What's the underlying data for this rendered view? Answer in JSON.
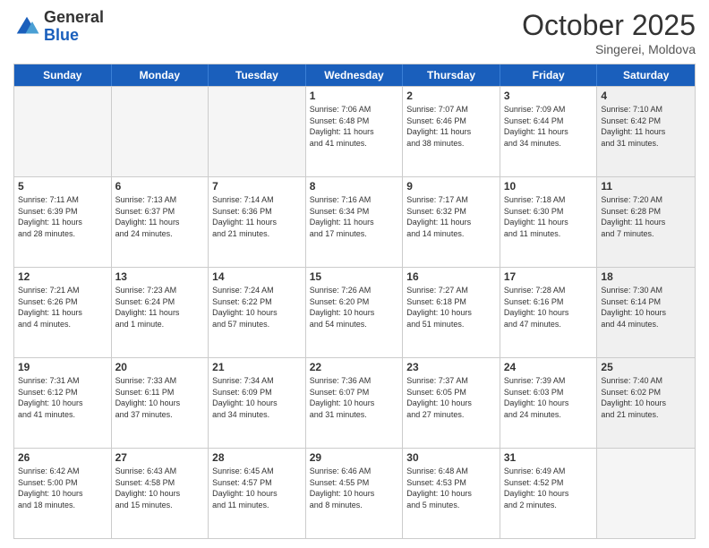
{
  "header": {
    "logo_general": "General",
    "logo_blue": "Blue",
    "month_title": "October 2025",
    "subtitle": "Singerei, Moldova"
  },
  "days_of_week": [
    "Sunday",
    "Monday",
    "Tuesday",
    "Wednesday",
    "Thursday",
    "Friday",
    "Saturday"
  ],
  "weeks": [
    [
      {
        "day": "",
        "info": "",
        "empty": true
      },
      {
        "day": "",
        "info": "",
        "empty": true
      },
      {
        "day": "",
        "info": "",
        "empty": true
      },
      {
        "day": "1",
        "info": "Sunrise: 7:06 AM\nSunset: 6:48 PM\nDaylight: 11 hours\nand 41 minutes.",
        "empty": false
      },
      {
        "day": "2",
        "info": "Sunrise: 7:07 AM\nSunset: 6:46 PM\nDaylight: 11 hours\nand 38 minutes.",
        "empty": false
      },
      {
        "day": "3",
        "info": "Sunrise: 7:09 AM\nSunset: 6:44 PM\nDaylight: 11 hours\nand 34 minutes.",
        "empty": false
      },
      {
        "day": "4",
        "info": "Sunrise: 7:10 AM\nSunset: 6:42 PM\nDaylight: 11 hours\nand 31 minutes.",
        "empty": false,
        "shaded": true
      }
    ],
    [
      {
        "day": "5",
        "info": "Sunrise: 7:11 AM\nSunset: 6:39 PM\nDaylight: 11 hours\nand 28 minutes.",
        "empty": false
      },
      {
        "day": "6",
        "info": "Sunrise: 7:13 AM\nSunset: 6:37 PM\nDaylight: 11 hours\nand 24 minutes.",
        "empty": false
      },
      {
        "day": "7",
        "info": "Sunrise: 7:14 AM\nSunset: 6:36 PM\nDaylight: 11 hours\nand 21 minutes.",
        "empty": false
      },
      {
        "day": "8",
        "info": "Sunrise: 7:16 AM\nSunset: 6:34 PM\nDaylight: 11 hours\nand 17 minutes.",
        "empty": false
      },
      {
        "day": "9",
        "info": "Sunrise: 7:17 AM\nSunset: 6:32 PM\nDaylight: 11 hours\nand 14 minutes.",
        "empty": false
      },
      {
        "day": "10",
        "info": "Sunrise: 7:18 AM\nSunset: 6:30 PM\nDaylight: 11 hours\nand 11 minutes.",
        "empty": false
      },
      {
        "day": "11",
        "info": "Sunrise: 7:20 AM\nSunset: 6:28 PM\nDaylight: 11 hours\nand 7 minutes.",
        "empty": false,
        "shaded": true
      }
    ],
    [
      {
        "day": "12",
        "info": "Sunrise: 7:21 AM\nSunset: 6:26 PM\nDaylight: 11 hours\nand 4 minutes.",
        "empty": false
      },
      {
        "day": "13",
        "info": "Sunrise: 7:23 AM\nSunset: 6:24 PM\nDaylight: 11 hours\nand 1 minute.",
        "empty": false
      },
      {
        "day": "14",
        "info": "Sunrise: 7:24 AM\nSunset: 6:22 PM\nDaylight: 10 hours\nand 57 minutes.",
        "empty": false
      },
      {
        "day": "15",
        "info": "Sunrise: 7:26 AM\nSunset: 6:20 PM\nDaylight: 10 hours\nand 54 minutes.",
        "empty": false
      },
      {
        "day": "16",
        "info": "Sunrise: 7:27 AM\nSunset: 6:18 PM\nDaylight: 10 hours\nand 51 minutes.",
        "empty": false
      },
      {
        "day": "17",
        "info": "Sunrise: 7:28 AM\nSunset: 6:16 PM\nDaylight: 10 hours\nand 47 minutes.",
        "empty": false
      },
      {
        "day": "18",
        "info": "Sunrise: 7:30 AM\nSunset: 6:14 PM\nDaylight: 10 hours\nand 44 minutes.",
        "empty": false,
        "shaded": true
      }
    ],
    [
      {
        "day": "19",
        "info": "Sunrise: 7:31 AM\nSunset: 6:12 PM\nDaylight: 10 hours\nand 41 minutes.",
        "empty": false
      },
      {
        "day": "20",
        "info": "Sunrise: 7:33 AM\nSunset: 6:11 PM\nDaylight: 10 hours\nand 37 minutes.",
        "empty": false
      },
      {
        "day": "21",
        "info": "Sunrise: 7:34 AM\nSunset: 6:09 PM\nDaylight: 10 hours\nand 34 minutes.",
        "empty": false
      },
      {
        "day": "22",
        "info": "Sunrise: 7:36 AM\nSunset: 6:07 PM\nDaylight: 10 hours\nand 31 minutes.",
        "empty": false
      },
      {
        "day": "23",
        "info": "Sunrise: 7:37 AM\nSunset: 6:05 PM\nDaylight: 10 hours\nand 27 minutes.",
        "empty": false
      },
      {
        "day": "24",
        "info": "Sunrise: 7:39 AM\nSunset: 6:03 PM\nDaylight: 10 hours\nand 24 minutes.",
        "empty": false
      },
      {
        "day": "25",
        "info": "Sunrise: 7:40 AM\nSunset: 6:02 PM\nDaylight: 10 hours\nand 21 minutes.",
        "empty": false,
        "shaded": true
      }
    ],
    [
      {
        "day": "26",
        "info": "Sunrise: 6:42 AM\nSunset: 5:00 PM\nDaylight: 10 hours\nand 18 minutes.",
        "empty": false
      },
      {
        "day": "27",
        "info": "Sunrise: 6:43 AM\nSunset: 4:58 PM\nDaylight: 10 hours\nand 15 minutes.",
        "empty": false
      },
      {
        "day": "28",
        "info": "Sunrise: 6:45 AM\nSunset: 4:57 PM\nDaylight: 10 hours\nand 11 minutes.",
        "empty": false
      },
      {
        "day": "29",
        "info": "Sunrise: 6:46 AM\nSunset: 4:55 PM\nDaylight: 10 hours\nand 8 minutes.",
        "empty": false
      },
      {
        "day": "30",
        "info": "Sunrise: 6:48 AM\nSunset: 4:53 PM\nDaylight: 10 hours\nand 5 minutes.",
        "empty": false
      },
      {
        "day": "31",
        "info": "Sunrise: 6:49 AM\nSunset: 4:52 PM\nDaylight: 10 hours\nand 2 minutes.",
        "empty": false
      },
      {
        "day": "",
        "info": "",
        "empty": true,
        "shaded": true
      }
    ]
  ]
}
